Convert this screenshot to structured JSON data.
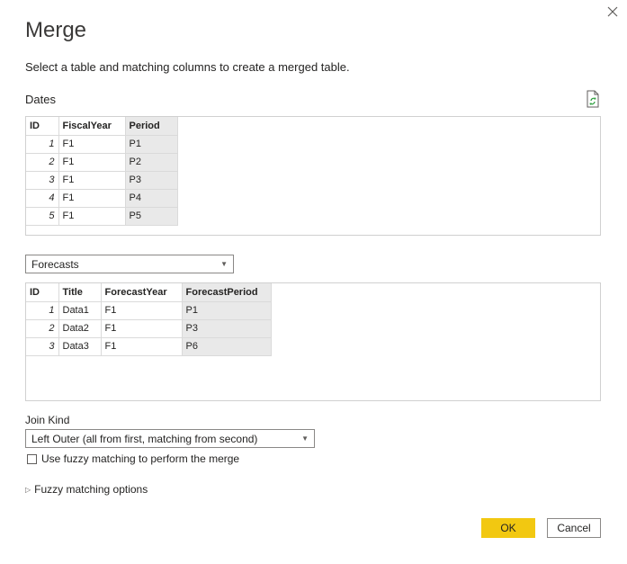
{
  "dialog": {
    "title": "Merge",
    "subtitle": "Select a table and matching columns to create a merged table."
  },
  "first_table": {
    "name": "Dates",
    "columns": [
      "ID",
      "FiscalYear",
      "Period"
    ],
    "rows": [
      [
        "1",
        "F1",
        "P1"
      ],
      [
        "2",
        "F1",
        "P2"
      ],
      [
        "3",
        "F1",
        "P3"
      ],
      [
        "4",
        "F1",
        "P4"
      ],
      [
        "5",
        "F1",
        "P5"
      ]
    ]
  },
  "second_table": {
    "selected": "Forecasts",
    "columns": [
      "ID",
      "Title",
      "ForecastYear",
      "ForecastPeriod"
    ],
    "rows": [
      [
        "1",
        "Data1",
        "F1",
        "P1"
      ],
      [
        "2",
        "Data2",
        "F1",
        "P3"
      ],
      [
        "3",
        "Data3",
        "F1",
        "P6"
      ]
    ]
  },
  "join": {
    "label": "Join Kind",
    "selected": "Left Outer (all from first, matching from second)"
  },
  "fuzzy": {
    "checkbox_label": "Use fuzzy matching to perform the merge",
    "options_label": "Fuzzy matching options",
    "checked": false
  },
  "buttons": {
    "ok": "OK",
    "cancel": "Cancel"
  },
  "colors": {
    "accent": "#f2c811",
    "selected_column": "#e9e9e9"
  },
  "icons": {
    "close": "close-icon",
    "refresh": "refresh-icon",
    "dropdown": "chevron-down-icon",
    "expand": "chevron-right-icon"
  }
}
